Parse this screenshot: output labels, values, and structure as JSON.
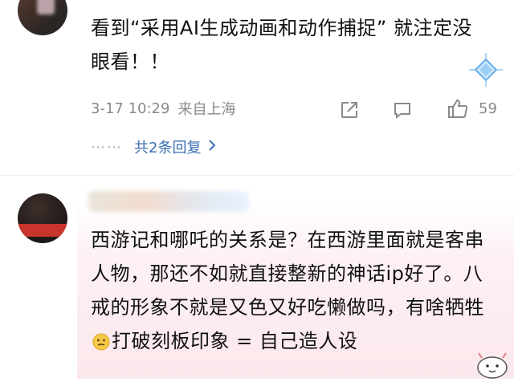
{
  "comment1": {
    "text": "看到“采用AI生成动画和动作捕捉” 就注定没眼看！！",
    "date": "3-17 10:29",
    "location": "来自上海",
    "like_count": "59",
    "replies_link": "共2条回复",
    "dots": "⋯⋯"
  },
  "comment2": {
    "text_before_emoji": "西游记和哪吒的关系是？在西游里面就是客串人物，那还不如就直接整新的神话ip好了。八戒的形象不就是又色又好吃懒做吗，有啥牺牲",
    "text_after_emoji": "打破刻板印象 = 自己造人设"
  },
  "icons": {
    "share": "share-icon",
    "comment": "comment-icon",
    "like": "thumbs-up-icon",
    "chevron": "chevron-right-icon",
    "emoji": "thinking-face-emoji"
  },
  "colors": {
    "link": "#3b6fb5",
    "meta": "#8a8a8a",
    "background_tint": "#fbe8ec"
  }
}
